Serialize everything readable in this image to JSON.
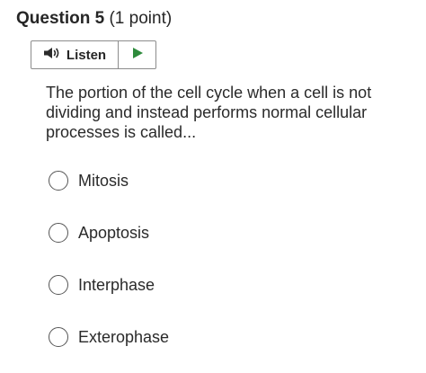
{
  "question": {
    "title": "Question 5",
    "points": "(1 point)",
    "text": "The portion of the cell cycle when a cell is not dividing and instead performs normal cellular processes is called..."
  },
  "listen": {
    "label": "Listen",
    "speaker_icon": "speaker-icon",
    "play_icon": "play-icon",
    "play_color": "#2e8b3c"
  },
  "options": [
    {
      "label": "Mitosis"
    },
    {
      "label": "Apoptosis"
    },
    {
      "label": "Interphase"
    },
    {
      "label": "Exterophase"
    }
  ]
}
